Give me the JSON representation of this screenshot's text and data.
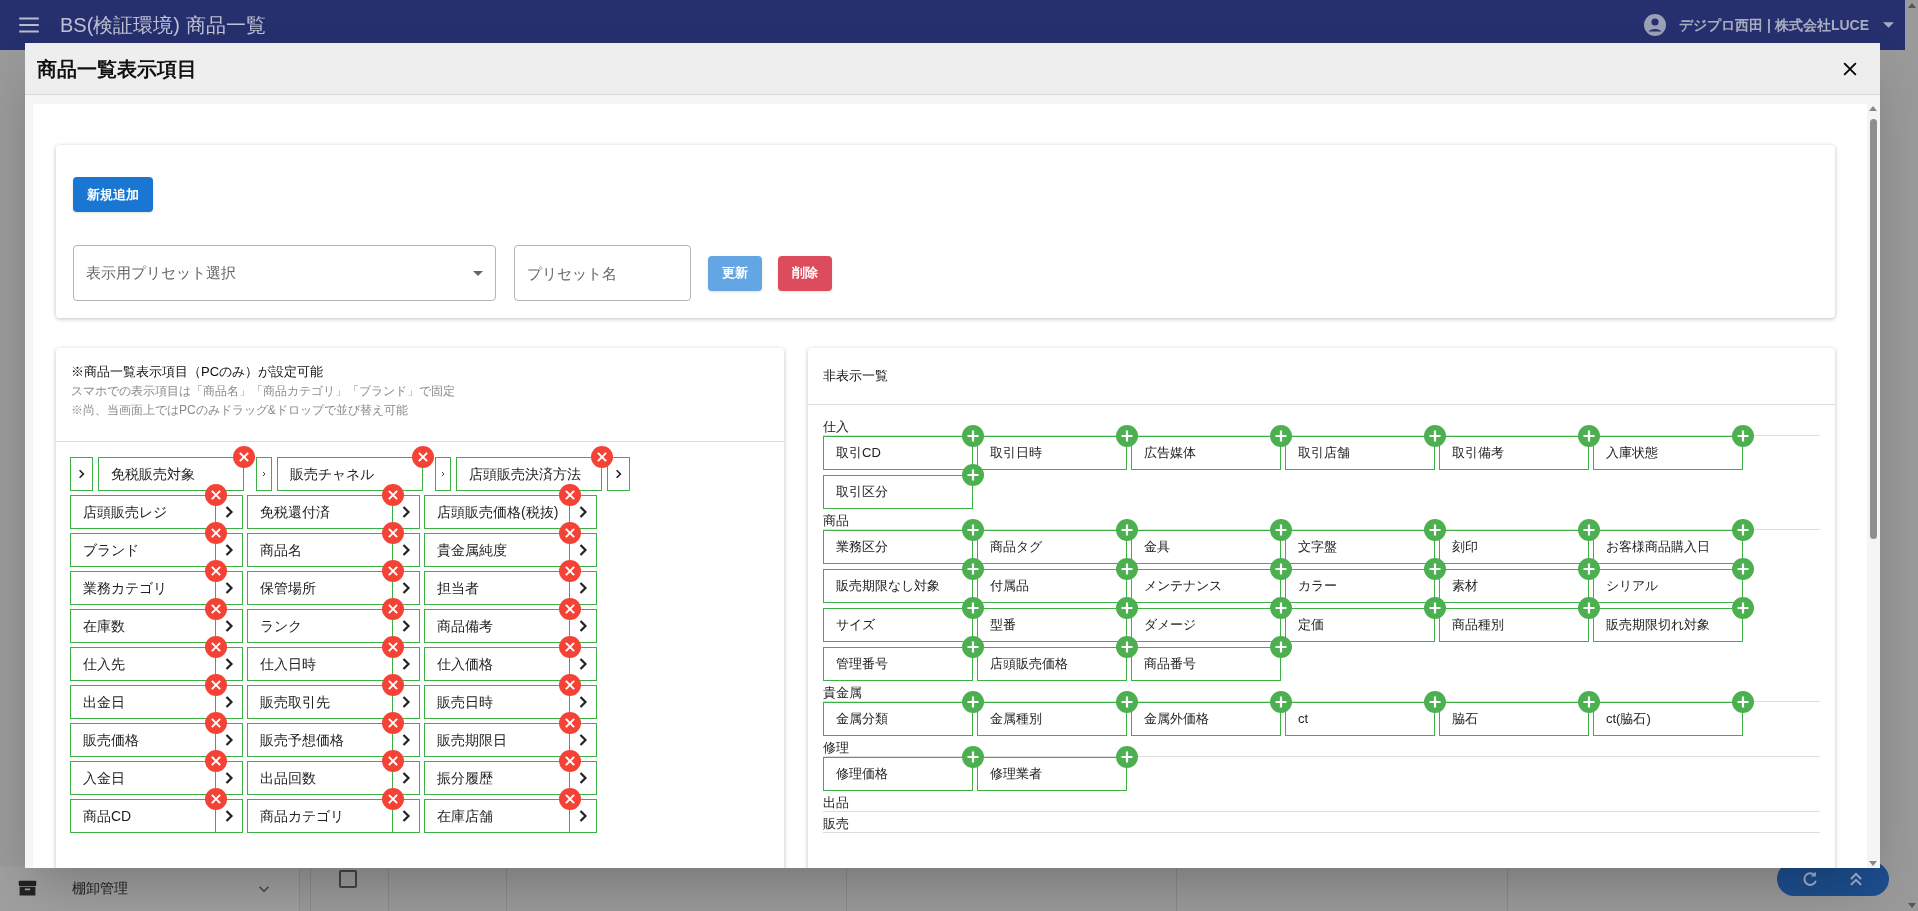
{
  "app_bar": {
    "title": "BS(検証環境) 商品一覧",
    "user": "デジプロ西田 | 株式会社LUCE"
  },
  "sidebar": {
    "items": [
      {
        "label": "棚卸管理",
        "expanded": false
      }
    ]
  },
  "dialog": {
    "title": "商品一覧表示項目",
    "preset_card": {
      "new_button": "新規追加",
      "preset_select": {
        "placeholder": "表示用プリセット選択"
      },
      "preset_name": {
        "placeholder": "プリセット名"
      },
      "update_button": {
        "label": "更新",
        "disabled": true
      },
      "delete_button": {
        "label": "削除",
        "disabled": false
      }
    },
    "visible_panel": {
      "title": "※商品一覧表示項目（PCのみ）が設定可能",
      "notes": [
        "スマホでの表示項目は「商品名」「商品カテゴリ」「ブランド」で固定",
        "※尚、当画面上ではPCのみドラッグ&ドロップで並び替え可能"
      ],
      "items": [
        "免税販売対象",
        "販売チャネル",
        "店頭販売決済方法",
        "店頭販売レジ",
        "免税還付済",
        "店頭販売価格(税抜)",
        "ブランド",
        "商品名",
        "貴金属純度",
        "業務カテゴリ",
        "保管場所",
        "担当者",
        "在庫数",
        "ランク",
        "商品備考",
        "仕入先",
        "仕入日時",
        "仕入価格",
        "出金日",
        "販売取引先",
        "販売日時",
        "販売価格",
        "販売予想価格",
        "販売期限日",
        "入金日",
        "出品回数",
        "振分履歴",
        "商品CD",
        "商品カテゴリ",
        "在庫店舗"
      ]
    },
    "hidden_panel": {
      "title": "非表示一覧",
      "groups": [
        {
          "label": "仕入",
          "items": [
            "取引CD",
            "取引日時",
            "広告媒体",
            "取引店舗",
            "取引備考",
            "入庫状態",
            "取引区分"
          ]
        },
        {
          "label": "商品",
          "items": [
            "業務区分",
            "商品タグ",
            "金具",
            "文字盤",
            "刻印",
            "お客様商品購入日",
            "販売期限なし対象",
            "付属品",
            "メンテナンス",
            "カラー",
            "素材",
            "シリアル",
            "サイズ",
            "型番",
            "ダメージ",
            "定価",
            "商品種別",
            "販売期限切れ対象",
            "管理番号",
            "店頭販売価格",
            "商品番号"
          ]
        },
        {
          "label": "貴金属",
          "items": [
            "金属分類",
            "金属種別",
            "金属外価格",
            "ct",
            "脇石",
            "ct(脇石)"
          ]
        },
        {
          "label": "修理",
          "items": [
            "修理価格",
            "修理業者"
          ]
        },
        {
          "label": "出品"
        },
        {
          "label": "販売"
        }
      ]
    }
  },
  "table": {
    "rows": [
      {
        "checked": false
      }
    ]
  }
}
